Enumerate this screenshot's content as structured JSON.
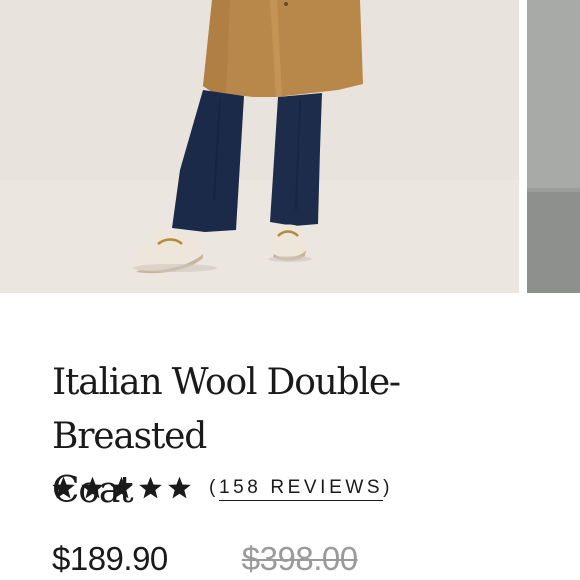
{
  "gallery": {
    "main_image_alt": "Model wearing camel coat, navy trousers and cream horsebit loafers",
    "next_image_alt": "Next product image"
  },
  "product": {
    "title_line1": "Italian Wool Double-Breasted",
    "title_line2": "Coat",
    "rating": {
      "stars_filled": 5,
      "stars_total": 5,
      "open_paren": "(",
      "count_label": "158 REVIEWS",
      "close_paren": ")"
    },
    "price": {
      "sale": "$189.90",
      "original": "$398.00"
    }
  },
  "colors": {
    "text": "#1a1a1a",
    "muted_price": "#9a9a9a",
    "coat": "#b8884a",
    "trousers": "#1c2a4a",
    "loafers": "#eee6da",
    "backdrop": "#e7e2dc"
  }
}
